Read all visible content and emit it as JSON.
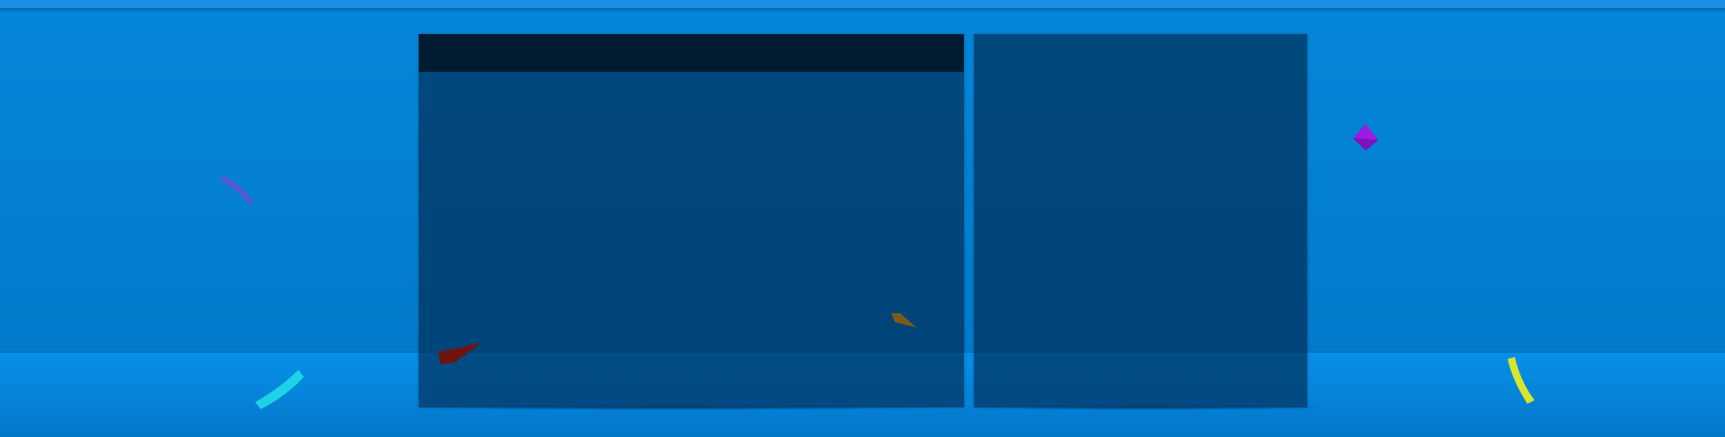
{
  "scene": {
    "colors": {
      "background": "#0785d9",
      "top_strip": "#1a90e4",
      "floor": "#0690e7",
      "panel": "#003a66",
      "panel_header": "#011c31"
    },
    "panels": [
      {
        "name": "main-panel",
        "has_header": true
      },
      {
        "name": "side-panel",
        "has_header": false
      }
    ],
    "confetti": [
      {
        "name": "confetti-purple-streak",
        "color": "#6a4fd6"
      },
      {
        "name": "confetti-cyan-streak",
        "color": "#1ed7e6"
      },
      {
        "name": "confetti-darkred-shard",
        "color": "#6e1410"
      },
      {
        "name": "confetti-brown-shard",
        "color": "#7a5a1a"
      },
      {
        "name": "confetti-violet-diamond",
        "color": "#9a1de0"
      },
      {
        "name": "confetti-yellow-streak",
        "color": "#d7e62a"
      }
    ]
  }
}
